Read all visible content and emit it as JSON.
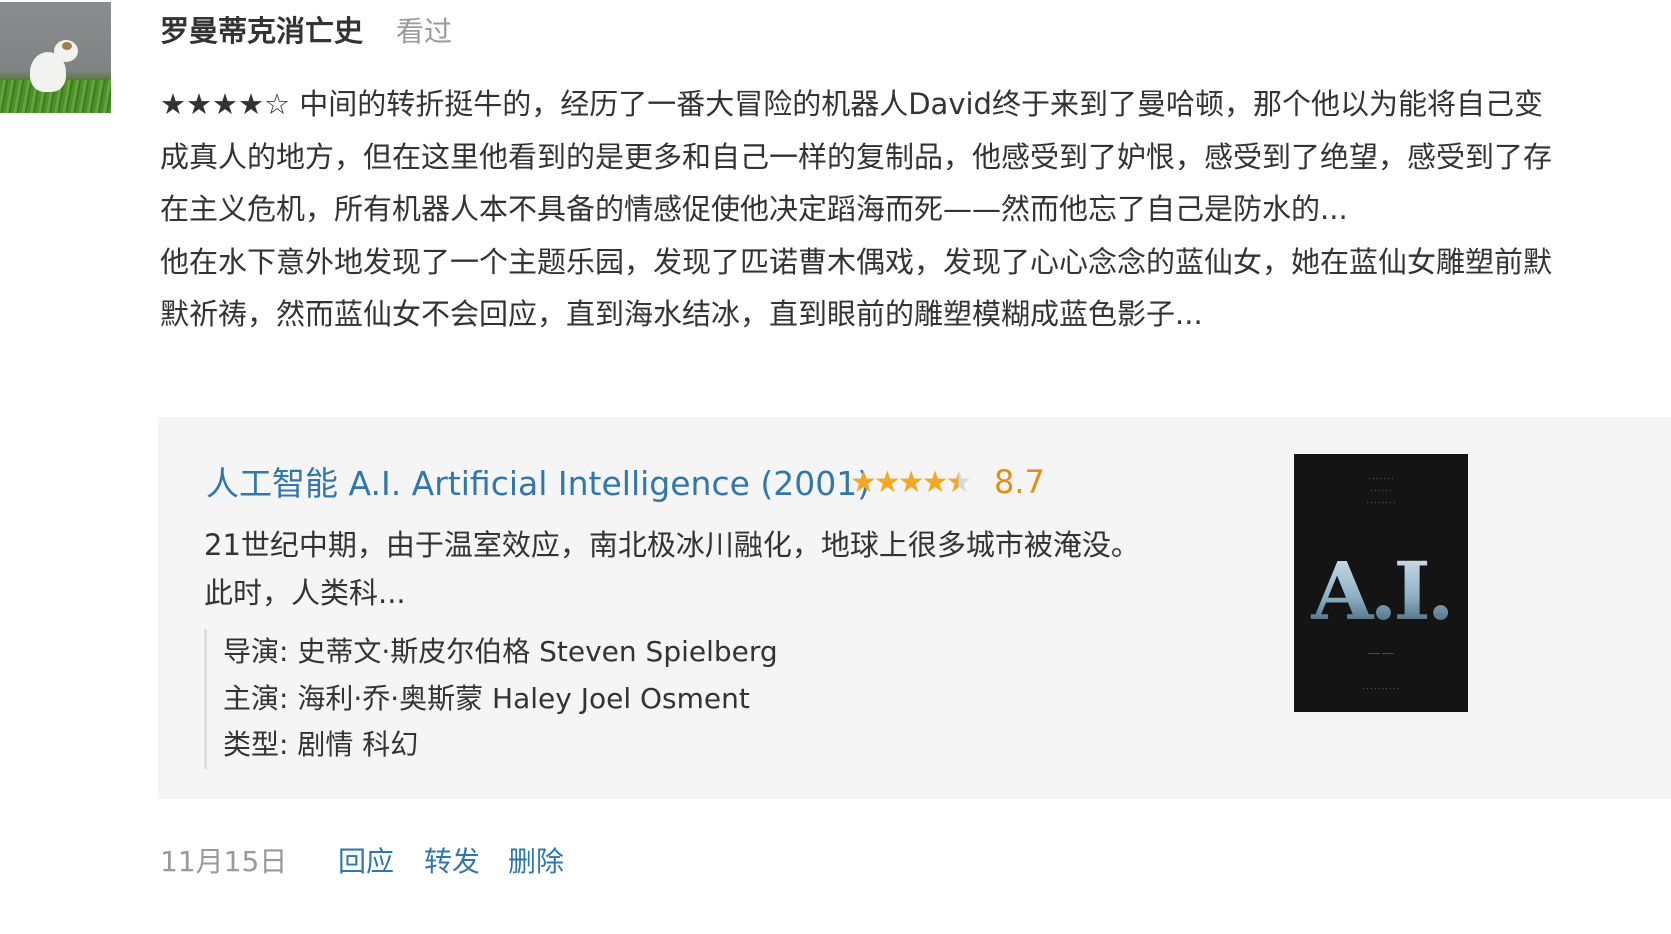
{
  "user": {
    "name": "罗曼蒂克消亡史",
    "action": "看过"
  },
  "review": {
    "rating_stars": "★★★★☆",
    "paragraphs": [
      "中间的转折挺牛的，经历了一番大冒险的机器人David终于来到了曼哈顿，那个他以为能将自己变成真人的地方，但在这里他看到的是更多和自己一样的复制品，他感受到了妒恨，感受到了绝望，感受到了存在主义危机，所有机器人本不具备的情感促使他决定蹈海而死——然而他忘了自己是防水的...",
      "他在水下意外地发现了一个主题乐园，发现了匹诺曹木偶戏，发现了心心念念的蓝仙女，她在蓝仙女雕塑前默默祈祷，然而蓝仙女不会回应，直到海水结冰，直到眼前的雕塑模糊成蓝色影子..."
    ]
  },
  "movie": {
    "title": "人工智能 A.I. Artificial Intelligence (2001)",
    "stars": {
      "full": "★★★★",
      "half": "★"
    },
    "rating": "8.7",
    "synopsis_line1": "21世纪中期，由于温室效应，南北极冰川融化，地球上很多城市被淹没。",
    "synopsis_line2": "此时，人类科...",
    "director": "导演: 史蒂文·斯皮尔伯格 Steven Spielberg",
    "cast": "主演: 海利·乔·奥斯蒙 Haley Joel Osment",
    "genre": "类型: 剧情 科幻",
    "poster_logo": "A.I."
  },
  "footer": {
    "date": "11月15日",
    "reply": "回应",
    "share": "转发",
    "delete": "删除"
  },
  "colors": {
    "link": "#3377aa",
    "score": "#e09015",
    "star": "#f5a623",
    "card_bg": "#f5f5f5",
    "muted": "#999999"
  }
}
